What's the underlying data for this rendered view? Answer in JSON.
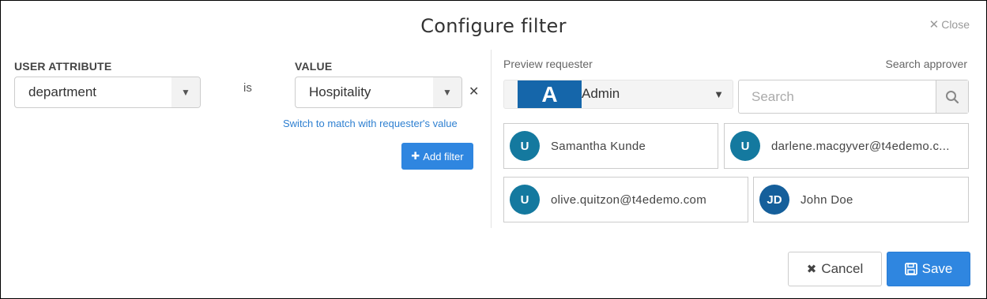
{
  "dialog": {
    "title": "Configure filter",
    "close_label": "Close"
  },
  "filter": {
    "attribute_header": "USER ATTRIBUTE",
    "value_header": "VALUE",
    "attribute_value": "department",
    "operator": "is",
    "value_value": "Hospitality",
    "switch_link": "Switch to match with requester's value",
    "add_filter_label": "Add filter"
  },
  "preview": {
    "requester_label": "Preview requester",
    "search_approver_label": "Search approver",
    "requester": {
      "avatar_initial": "A",
      "name": "Admin"
    },
    "search_placeholder": "Search",
    "approvers": [
      {
        "initials": "U",
        "name": "Samantha Kunde"
      },
      {
        "initials": "U",
        "name": "darlene.macgyver@t4edemo.c..."
      },
      {
        "initials": "U",
        "name": "olive.quitzon@t4edemo.com"
      },
      {
        "initials": "JD",
        "name": "John Doe"
      }
    ]
  },
  "footer": {
    "cancel_label": "Cancel",
    "save_label": "Save"
  },
  "colors": {
    "primary": "#2f86e0",
    "avatar_teal": "#14799f",
    "avatar_blue": "#155f9b"
  }
}
